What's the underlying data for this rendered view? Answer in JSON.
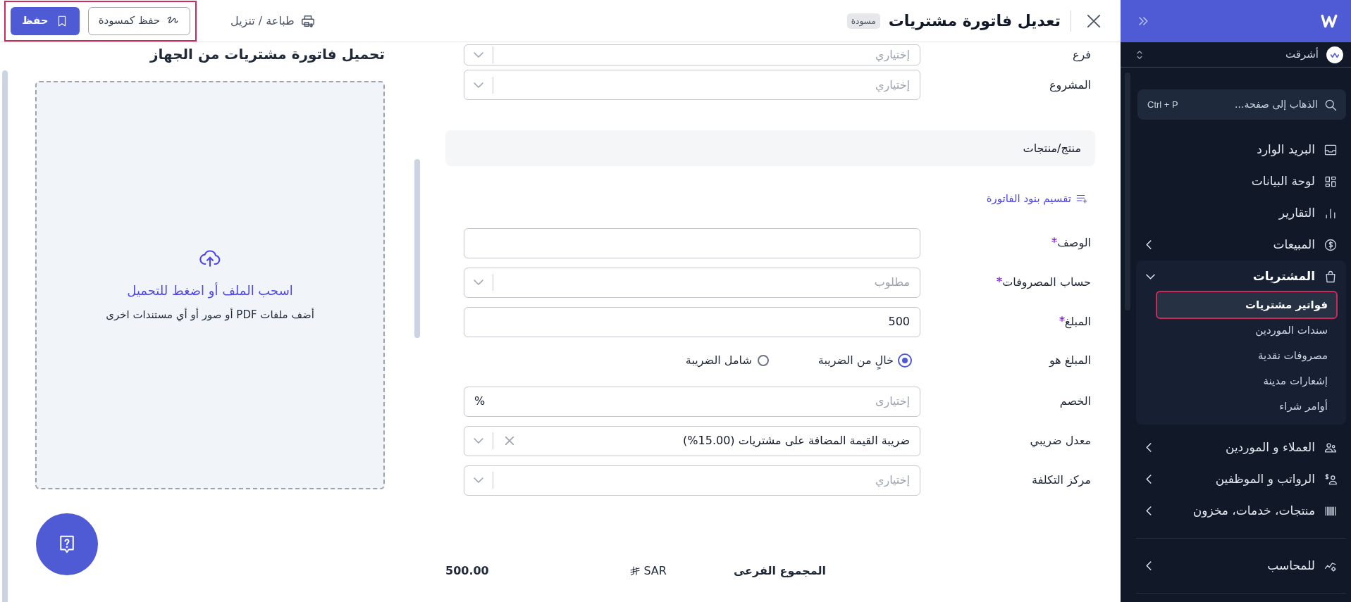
{
  "topbar": {
    "title": "تعديل فاتورة مشتريات",
    "status_badge": "مسودة",
    "print_link": "طباعة / تنزيل",
    "draft_button": "حفظ كمسودة",
    "save_button": "حفظ",
    "actions_highlighted": true
  },
  "form": {
    "top_fields": [
      {
        "label": "فرع",
        "kind": "select",
        "required": false,
        "placeholder": "إختياري"
      },
      {
        "label": "المشروع",
        "kind": "select",
        "required": false,
        "placeholder": "إختياري"
      }
    ],
    "section_title": "منتج/منتجات",
    "split_link": "تقسيم بنود الفاتورة",
    "fields": [
      {
        "label": "الوصف",
        "kind": "text",
        "required": true
      },
      {
        "label": "حساب المصروفات",
        "kind": "select",
        "required": true,
        "placeholder": "مطلوب"
      },
      {
        "label": "المبلغ",
        "kind": "text",
        "required": true,
        "value": "500"
      },
      {
        "label": "المبلغ هو",
        "kind": "radio",
        "required": false,
        "options": [
          {
            "label": "خالٍ من الضريبة",
            "selected": true
          },
          {
            "label": "شامل الضريبة",
            "selected": false
          }
        ]
      },
      {
        "label": "الخصم",
        "kind": "percent",
        "required": false,
        "placeholder": "إختيارى",
        "suffix": "%"
      },
      {
        "label": "معدل ضريبي",
        "kind": "select",
        "required": false,
        "value": "ضريبة القيمة المضافة على مشتريات (15.00%)",
        "clearable": true
      },
      {
        "label": "مركز التكلفة",
        "kind": "select",
        "required": false,
        "placeholder": "إختياري"
      }
    ],
    "subtotal": {
      "label": "المجموع الفرعى",
      "currency": "SAR",
      "amount": "500.00"
    }
  },
  "upload": {
    "title": "تحميل فاتورة مشتريات من الجهاز",
    "prompt": "اسحب الملف أو اضغط للتحميل",
    "hint": "أضف ملفات PDF أو صور أو أي مستندات اخرى"
  },
  "sidebar": {
    "org_name": "أشرقت",
    "search": {
      "placeholder": "الذهاب إلى صفحة...",
      "shortcut": "Ctrl + P"
    },
    "sections": [
      {
        "items": [
          {
            "label": "البريد الوارد"
          },
          {
            "label": "لوحة البيانات"
          },
          {
            "label": "التقارير"
          },
          {
            "label": "المبيعات",
            "expanded": false
          },
          {
            "label": "المشتريات",
            "expanded": true,
            "children": [
              {
                "label": "فواتير مشتريات",
                "selected": true,
                "highlighted": true
              },
              {
                "label": "سندات الموردين",
                "selected": false,
                "highlighted": false
              },
              {
                "label": "مصروفات نقدية",
                "selected": false,
                "highlighted": false
              },
              {
                "label": "إشعارات مدينة",
                "selected": false,
                "highlighted": false
              },
              {
                "label": "أوامر شراء",
                "selected": false,
                "highlighted": false
              }
            ]
          },
          {
            "label": "العملاء و الموردين",
            "expanded": false
          },
          {
            "label": "الرواتب و الموظفين",
            "expanded": false
          },
          {
            "label": "منتجات، خدمات، مخزون",
            "expanded": false
          }
        ]
      },
      {
        "items": [
          {
            "label": "للمحاسب",
            "expanded": false
          }
        ]
      }
    ]
  }
}
